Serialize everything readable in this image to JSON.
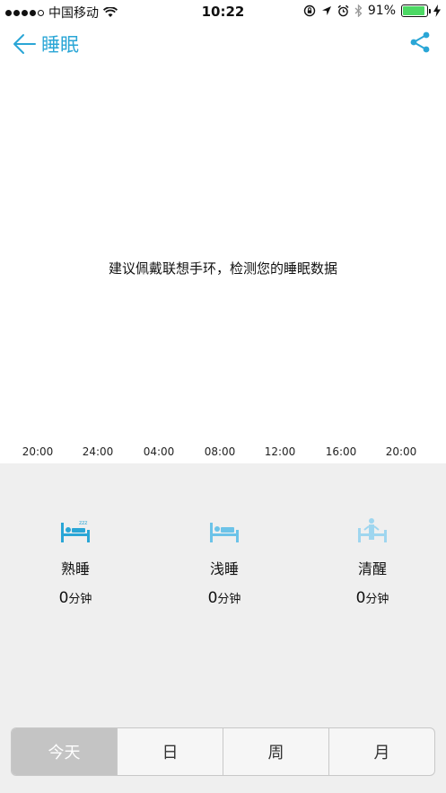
{
  "status_bar": {
    "carrier": "中国移动",
    "time": "10:22",
    "battery_percent": "91%"
  },
  "nav": {
    "title": "睡眠",
    "accent_color": "#2aa6d6"
  },
  "message": "建议佩戴联想手环，检测您的睡眠数据",
  "time_axis": [
    "20:00",
    "24:00",
    "04:00",
    "08:00",
    "12:00",
    "16:00",
    "20:00"
  ],
  "stats": [
    {
      "label": "熟睡",
      "value": "0",
      "unit": "分钟",
      "icon": "deep-sleep-bed-icon",
      "color": "#2aa6d6"
    },
    {
      "label": "浅睡",
      "value": "0",
      "unit": "分钟",
      "icon": "light-sleep-bed-icon",
      "color": "#6cc3e8"
    },
    {
      "label": "清醒",
      "value": "0",
      "unit": "分钟",
      "icon": "awake-person-icon",
      "color": "#9fd6ef"
    }
  ],
  "tabs": [
    {
      "label": "今天",
      "active": true
    },
    {
      "label": "日",
      "active": false
    },
    {
      "label": "周",
      "active": false
    },
    {
      "label": "月",
      "active": false
    }
  ]
}
